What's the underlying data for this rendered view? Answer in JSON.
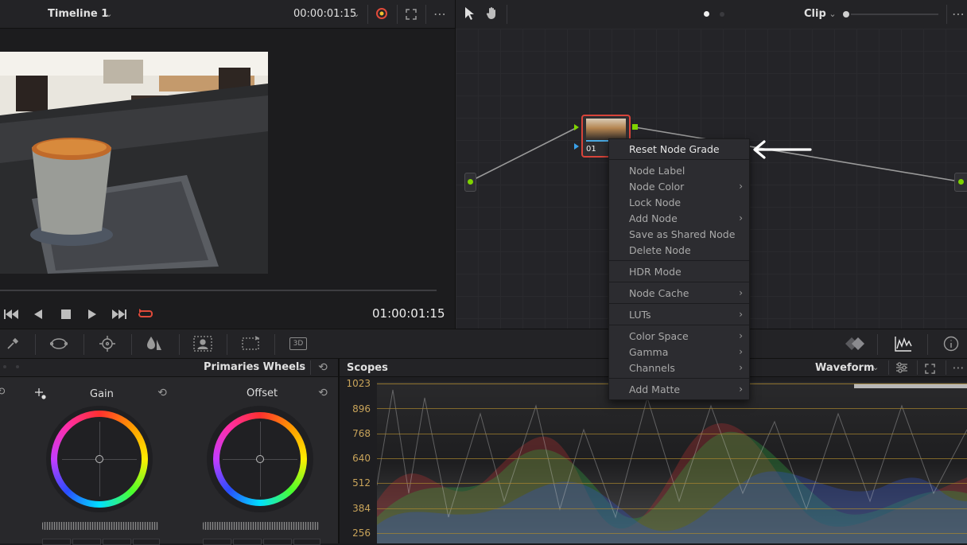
{
  "viewer": {
    "timeline_label": "Timeline 1",
    "timecode_top": "00:00:01:15",
    "timecode_bottom": "01:00:01:15"
  },
  "node_editor": {
    "mode_label": "Clip",
    "node": {
      "number": "01"
    }
  },
  "context_menu": {
    "items": [
      {
        "label": "Reset Node Grade",
        "submenu": false
      },
      {
        "label": "Node Label",
        "submenu": false
      },
      {
        "label": "Node Color",
        "submenu": true
      },
      {
        "label": "Lock Node",
        "submenu": false
      },
      {
        "label": "Add Node",
        "submenu": true
      },
      {
        "label": "Save as Shared Node",
        "submenu": false
      },
      {
        "label": "Delete Node",
        "submenu": false
      },
      {
        "label": "HDR Mode",
        "submenu": false
      },
      {
        "label": "Node Cache",
        "submenu": true
      },
      {
        "label": "LUTs",
        "submenu": true
      },
      {
        "label": "Color Space",
        "submenu": true
      },
      {
        "label": "Gamma",
        "submenu": true
      },
      {
        "label": "Channels",
        "submenu": true
      },
      {
        "label": "Add Matte",
        "submenu": true
      }
    ]
  },
  "toolbar": {
    "three_d_label": "3D"
  },
  "wheels_panel": {
    "title": "Primaries Wheels",
    "wheels": [
      {
        "label": "Gain"
      },
      {
        "label": "Offset"
      }
    ]
  },
  "scopes_panel": {
    "title": "Scopes",
    "mode": "Waveform",
    "scale": [
      "1023",
      "896",
      "768",
      "640",
      "512",
      "384",
      "256"
    ]
  },
  "colors": {
    "accent_red": "#e04a3a",
    "node_green": "#7fd400",
    "scale_gold": "#c9a45a"
  }
}
